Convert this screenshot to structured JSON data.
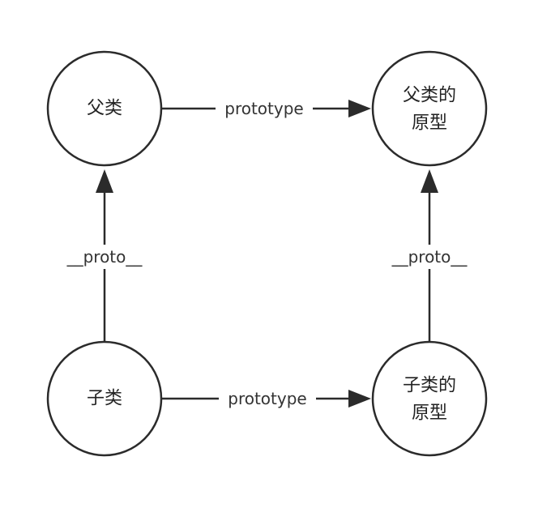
{
  "nodes": {
    "parent_class": {
      "label": "父类"
    },
    "parent_prototype": {
      "line1": "父类的",
      "line2": "原型"
    },
    "child_class": {
      "label": "子类"
    },
    "child_prototype": {
      "line1": "子类的",
      "line2": "原型"
    }
  },
  "edges": {
    "parent_to_parent_prototype": {
      "label": "prototype"
    },
    "child_to_child_prototype": {
      "label": "prototype"
    },
    "child_to_parent": {
      "label": "__proto__"
    },
    "child_prototype_to_parent_prototype": {
      "label": "__proto__"
    }
  },
  "colors": {
    "stroke": "#2b2b2b",
    "background": "#ffffff"
  }
}
